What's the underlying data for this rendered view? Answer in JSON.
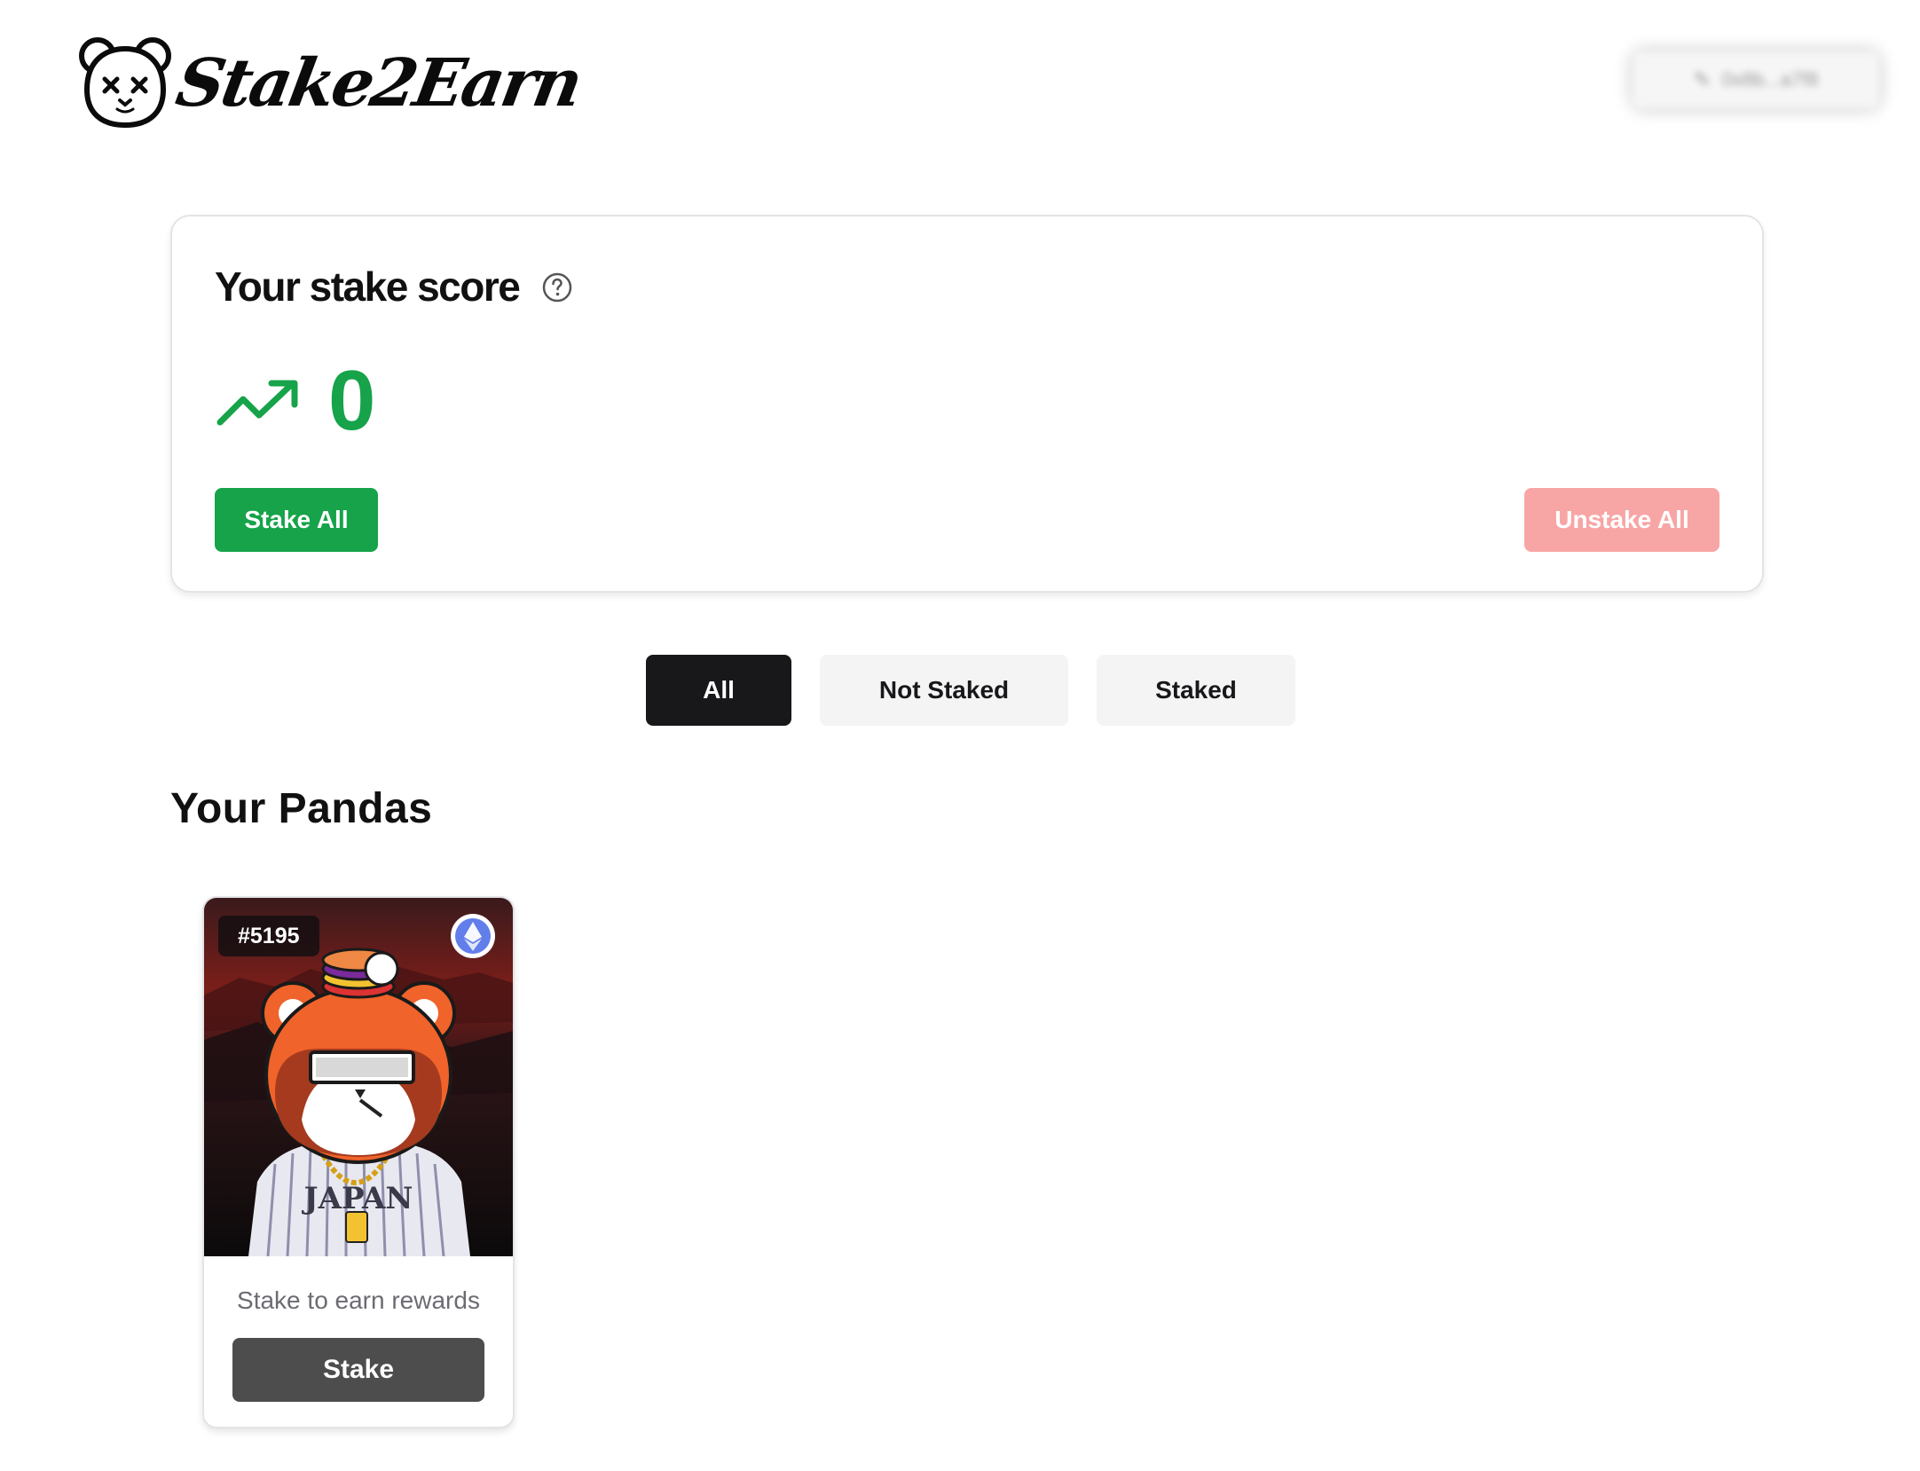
{
  "header": {
    "logo_text": "Stake2Earn",
    "wallet_label": "0x8b...a7f8"
  },
  "score_card": {
    "title": "Your stake score",
    "score": "0",
    "stake_all_label": "Stake All",
    "unstake_all_label": "Unstake All"
  },
  "filters": {
    "tabs": [
      {
        "label": "All",
        "active": true
      },
      {
        "label": "Not Staked",
        "active": false
      },
      {
        "label": "Staked",
        "active": false
      }
    ]
  },
  "section": {
    "title": "Your Pandas"
  },
  "pandas": [
    {
      "token_id": "#5195",
      "chain_icon": "ethereum-icon",
      "caption": "Stake to earn rewards",
      "button_label": "Stake",
      "jersey_text": "JAPAN"
    }
  ],
  "colors": {
    "green": "#16a34a",
    "red_disabled": "#f8a5a5",
    "dark": "#18181b",
    "stake_button": "#4d4d4d"
  }
}
